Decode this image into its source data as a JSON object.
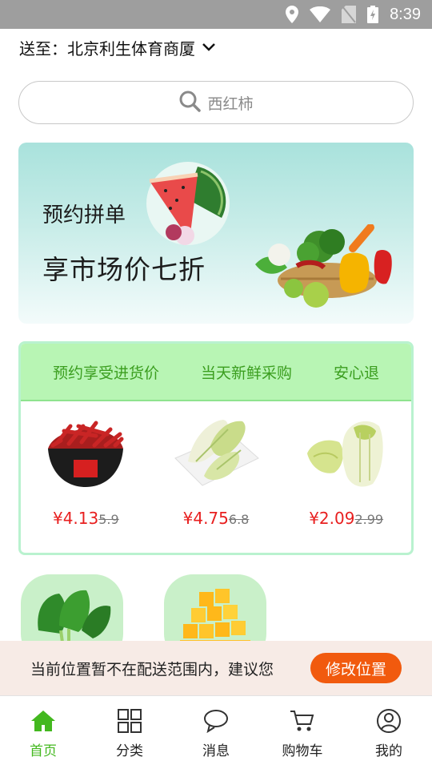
{
  "status_bar": {
    "time": "8:39"
  },
  "location": {
    "label": "送至：",
    "address": "北京利生体育商厦"
  },
  "search": {
    "placeholder": "西红柿"
  },
  "banner": {
    "line1": "预约拼单",
    "line2": "享市场价七折"
  },
  "promo": {
    "features": [
      "预约享受进货价",
      "当天新鲜采购",
      "安心退"
    ],
    "products": [
      {
        "price": "¥4.13",
        "original": "5.9",
        "image": "dried-chili-bowl"
      },
      {
        "price": "¥4.75",
        "original": "6.8",
        "image": "baby-cabbage-plate"
      },
      {
        "price": "¥2.09",
        "original": "2.99",
        "image": "napa-cabbage"
      }
    ]
  },
  "categories": [
    {
      "image": "leafy-greens"
    },
    {
      "image": "mango-fruit"
    }
  ],
  "notice": {
    "text": "当前位置暂不在配送范围内，建议您",
    "button": "修改位置"
  },
  "nav": {
    "items": [
      {
        "label": "首页",
        "icon": "home-icon",
        "active": true
      },
      {
        "label": "分类",
        "icon": "grid-icon",
        "active": false
      },
      {
        "label": "消息",
        "icon": "chat-icon",
        "active": false
      },
      {
        "label": "购物车",
        "icon": "cart-icon",
        "active": false
      },
      {
        "label": "我的",
        "icon": "user-icon",
        "active": false
      }
    ]
  },
  "colors": {
    "accent_green": "#43b81f",
    "price_red": "#e81f1f",
    "button_orange": "#f15a0e",
    "promo_green": "#b8f5b4"
  }
}
